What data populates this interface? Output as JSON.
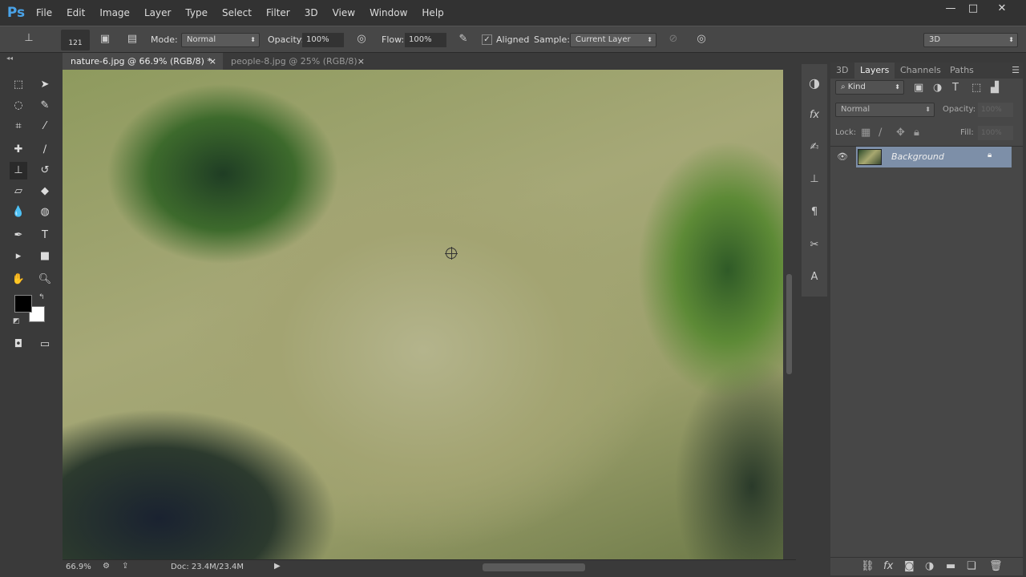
{
  "app": {
    "logo": "Ps"
  },
  "menu": [
    "File",
    "Edit",
    "Image",
    "Layer",
    "Type",
    "Select",
    "Filter",
    "3D",
    "View",
    "Window",
    "Help"
  ],
  "window_controls": {
    "minimize": "—",
    "maximize": "□",
    "close": "✕"
  },
  "options": {
    "brush_size": "121",
    "mode_label": "Mode:",
    "mode": "Normal",
    "opacity_label": "Opacity:",
    "opacity": "100%",
    "flow_label": "Flow:",
    "flow": "100%",
    "aligned_label": "Aligned",
    "aligned_checked": true,
    "sample_label": "Sample:",
    "sample": "Current Layer",
    "workspace": "3D"
  },
  "tabs": [
    {
      "label": "nature-6.jpg @ 66.9% (RGB/8) *",
      "active": true
    },
    {
      "label": "people-8.jpg @ 25% (RGB/8)",
      "active": false
    }
  ],
  "tab_close": "×",
  "status": {
    "zoom": "66.9%",
    "doc": "Doc: 23.4M/23.4M"
  },
  "panel": {
    "tabs": [
      "3D",
      "Layers",
      "Channels",
      "Paths"
    ],
    "active_tab": "Layers",
    "filter_kind": "Kind",
    "blend_mode": "Normal",
    "opacity_label": "Opacity:",
    "opacity": "100%",
    "lock_label": "Lock:",
    "fill_label": "Fill:",
    "fill": "100%",
    "layers": [
      {
        "name": "Background",
        "visible": true,
        "locked": true,
        "selected": true
      }
    ]
  },
  "colors": {
    "foreground": "#000000",
    "background": "#ffffff",
    "accent": "#4aa3e8",
    "layer_selected": "#7d8fa8"
  }
}
